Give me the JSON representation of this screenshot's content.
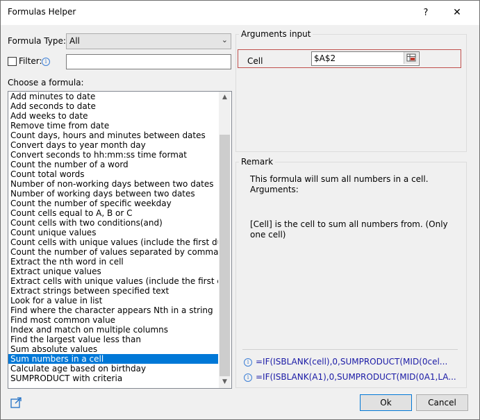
{
  "window": {
    "title": "Formulas Helper",
    "help_glyph": "?",
    "close_glyph": "✕"
  },
  "left": {
    "formula_type_label": "Formula Type:",
    "formula_type_value": "All",
    "filter_label": "Filter:",
    "filter_value": "",
    "choose_label": "Choose a formula:",
    "formulas": [
      "Add minutes to date",
      "Add seconds to date",
      "Add weeks to date",
      "Remove time from date",
      "Count days, hours and minutes between dates",
      "Convert days to year month day",
      "Convert seconds to hh:mm:ss time format",
      "Count the number of a word",
      "Count total words",
      "Number of non-working days between two dates",
      "Number of working days between two dates",
      "Count the number of specific weekday",
      "Count cells equal to A, B or C",
      "Count cells with two conditions(and)",
      "Count unique values",
      "Count cells with unique values (include the first duplica",
      "Count the number of values separated by comma",
      "Extract the nth word in cell",
      "Extract unique values",
      "Extract cells with unique values (include the first duplic",
      "Extract strings between specified text",
      "Look for a value in list",
      "Find where the character appears Nth in a string",
      "Find most common value",
      "Index and match on multiple columns",
      "Find the largest value less than",
      "Sum absolute values",
      "Sum numbers in a cell",
      "Calculate age based on birthday",
      "SUMPRODUCT with criteria"
    ],
    "selected_index": 27
  },
  "arguments": {
    "title": "Arguments input",
    "cell_label": "Cell",
    "cell_value": "$A$2"
  },
  "remark": {
    "title": "Remark",
    "line1": "This formula will sum all numbers in a cell. Arguments:",
    "line2": "[Cell] is the cell to sum all numbers from. (Only one cell)",
    "example1": "=IF(ISBLANK(cell),0,SUMPRODUCT(MID(0cel...",
    "example2": "=IF(ISBLANK(A1),0,SUMPRODUCT(MID(0A1,LA..."
  },
  "buttons": {
    "ok": "Ok",
    "cancel": "Cancel"
  },
  "colors": {
    "accent": "#0078d7",
    "highlight_border": "#c0504d",
    "link": "#1a1aa6"
  },
  "icons": {
    "info": "info-icon",
    "share": "share-icon",
    "range": "range-select-icon"
  }
}
